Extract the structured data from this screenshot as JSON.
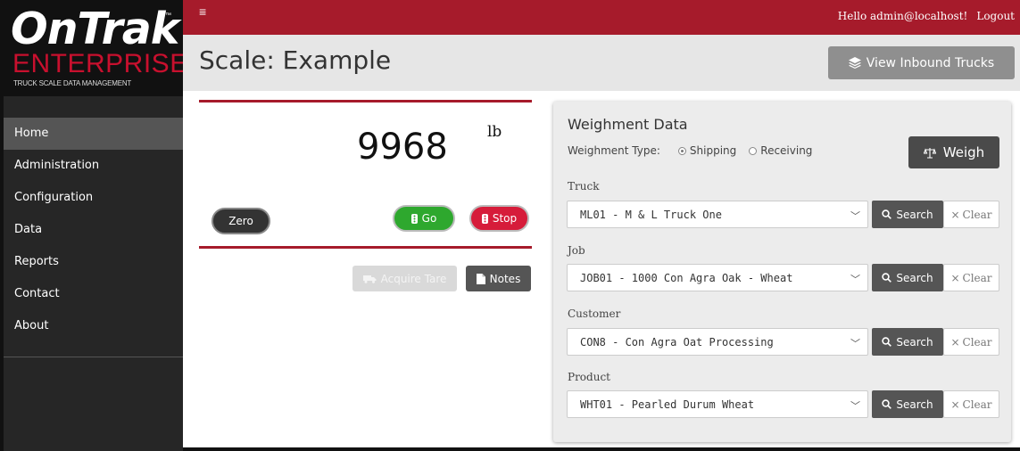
{
  "logo": {
    "name": "OnTrak",
    "tm": "™",
    "edition": "ENTERPRISE",
    "tagline": "TRUCK SCALE DATA MANAGEMENT"
  },
  "nav": [
    {
      "label": "Home",
      "active": true
    },
    {
      "label": "Administration"
    },
    {
      "label": "Configuration"
    },
    {
      "label": "Data"
    },
    {
      "label": "Reports"
    },
    {
      "label": "Contact"
    },
    {
      "label": "About"
    }
  ],
  "topbar": {
    "menu_icon": "hamburger-icon",
    "greeting": "Hello admin@localhost!",
    "logout": "Logout"
  },
  "header": {
    "title": "Scale: Example",
    "inbound_button": "View Inbound Trucks",
    "inbound_icon": "layers-icon"
  },
  "scale": {
    "weight": "9968",
    "unit": "lb",
    "zero_label": "Zero",
    "go_label": "Go",
    "stop_label": "Stop",
    "acquire_tare_label": "Acquire Tare",
    "notes_label": "Notes"
  },
  "weighment": {
    "title": "Weighment Data",
    "type_label": "Weighment Type:",
    "type_options": [
      "Shipping",
      "Receiving"
    ],
    "type_selected": "Shipping",
    "weigh_button": "Weigh",
    "search_label": "Search",
    "clear_label": "Clear",
    "fields": [
      {
        "label": "Truck",
        "value": "ML01 - M & L Truck One"
      },
      {
        "label": "Job",
        "value": "JOB01 - 1000 Con Agra Oak - Wheat"
      },
      {
        "label": "Customer",
        "value": "CON8 - Con Agra Oat Processing"
      },
      {
        "label": "Product",
        "value": "WHT01 - Pearled Durum Wheat"
      }
    ]
  },
  "colors": {
    "brand_red": "#a61b2b",
    "go_green": "#2ea82e",
    "stop_red": "#d61c3a",
    "sidebar": "#262626"
  }
}
